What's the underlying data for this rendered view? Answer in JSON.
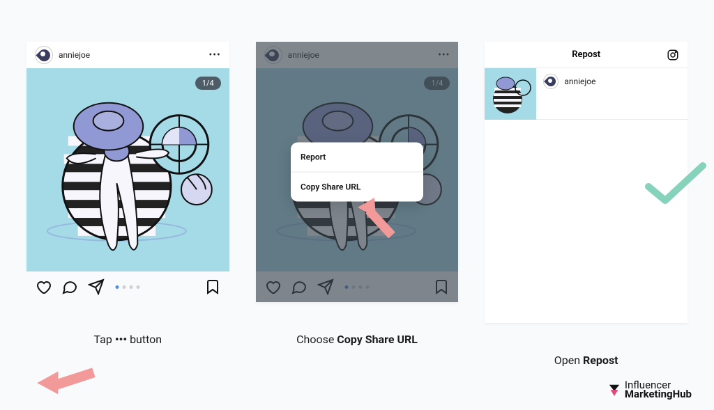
{
  "panels": {
    "p1": {
      "username": "anniejoe",
      "counter": "1/4",
      "caption_pre": "Tap ",
      "caption_bold": "•••",
      "caption_post": " button"
    },
    "p2": {
      "username": "anniejoe",
      "counter": "1/4",
      "sheet": {
        "report": "Report",
        "copy": "Copy Share URL"
      },
      "caption_pre": "Choose ",
      "caption_bold": "Copy Share URL",
      "caption_post": ""
    },
    "p3": {
      "title": "Repost",
      "username": "anniejoe",
      "caption_pre": "Open ",
      "caption_bold": "Repost",
      "caption_post": ""
    }
  },
  "logo": {
    "line1": "Influencer",
    "line2": "MarketingHub"
  }
}
